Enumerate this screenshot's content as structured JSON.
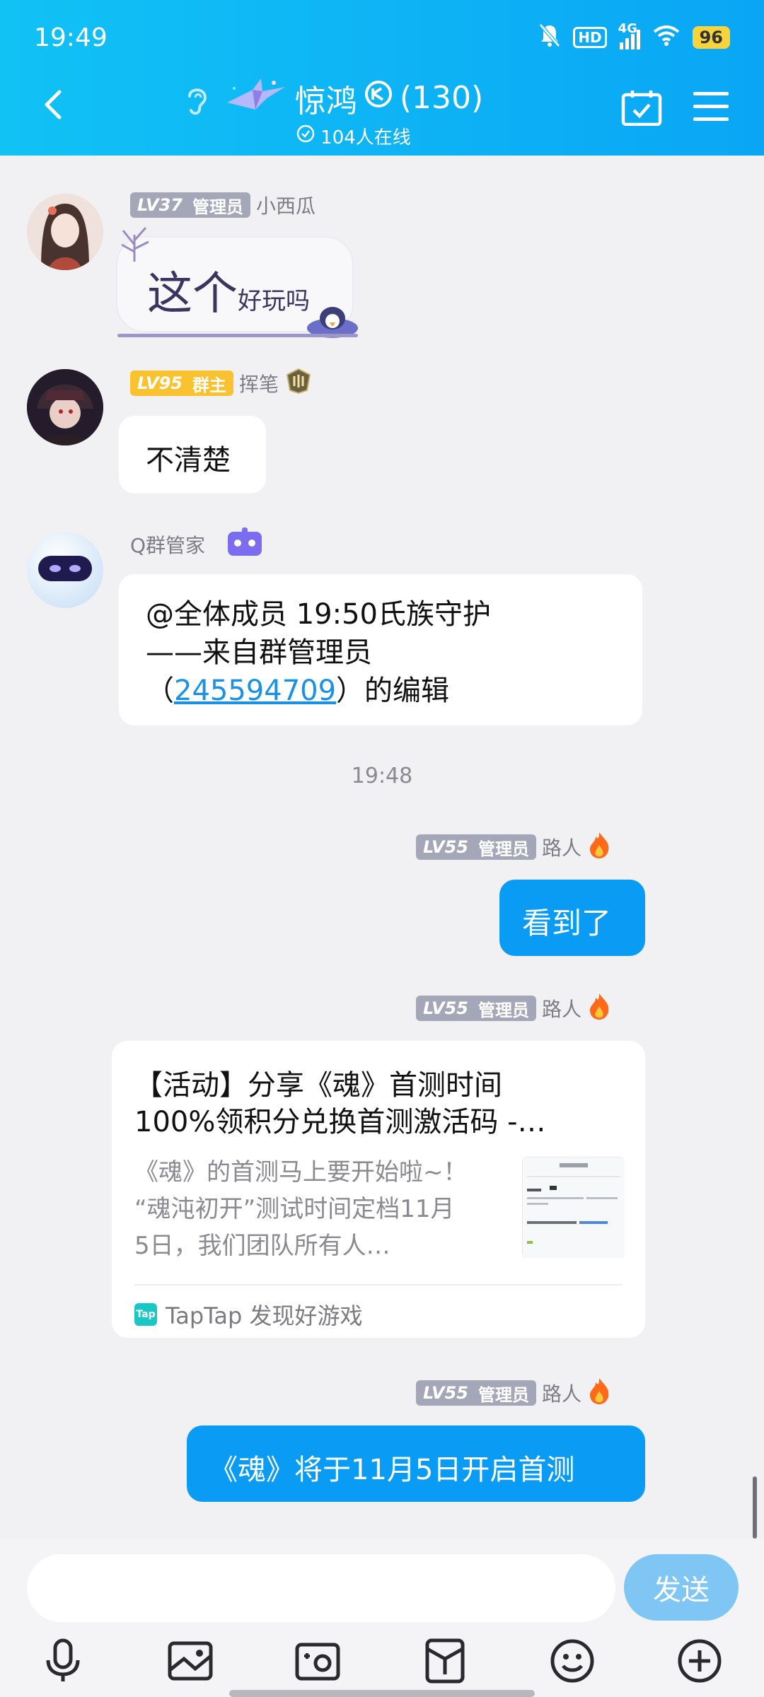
{
  "status": {
    "time": "19:49",
    "network": "4G",
    "hd": "HD",
    "battery": "96"
  },
  "header": {
    "title_name": "惊鸿",
    "title_count": "(130)",
    "online_text": "104人在线",
    "colors": {
      "header_start": "#11c2f5",
      "header_end": "#0aa6f5"
    }
  },
  "messages": [
    {
      "sender": "小西瓜",
      "level": "LV37",
      "role": "管理员",
      "text_big": "这个",
      "text_small": "好玩吗"
    },
    {
      "sender": "挥笔",
      "level": "LV95",
      "role": "群主",
      "text": "不清楚"
    },
    {
      "sender": "Q群管家",
      "line1": "@全体成员 19:50氏族守护",
      "line2": "——来自群管理员",
      "line3_open": "（",
      "line3_link": "245594709",
      "line3_close": "）的编辑"
    }
  ],
  "time_divider": "19:48",
  "own_messages": [
    {
      "sender": "路人",
      "level": "LV55",
      "role": "管理员",
      "text": "看到了"
    },
    {
      "sender": "路人",
      "level": "LV55",
      "role": "管理员",
      "card": {
        "title_line1": "【活动】分享《魂》首测时间",
        "title_line2": "100%领积分兑换首测激活码 -…",
        "desc_line1": "《魂》的首测马上要开始啦~！",
        "desc_line2": "“魂沌初开”测试时间定档11月",
        "desc_line3": "5日，我们团队所有人…",
        "logo": "Tap",
        "source": "TapTap 发现好游戏"
      }
    },
    {
      "sender": "路人",
      "level": "LV55",
      "role": "管理员",
      "text": "《魂》将于11月5日开启首测"
    }
  ],
  "input": {
    "value": "",
    "send_label": "发送"
  },
  "toolbar_icons": [
    "microphone-icon",
    "image-icon",
    "camera-icon",
    "red-packet-icon",
    "emoji-icon",
    "plus-icon"
  ]
}
